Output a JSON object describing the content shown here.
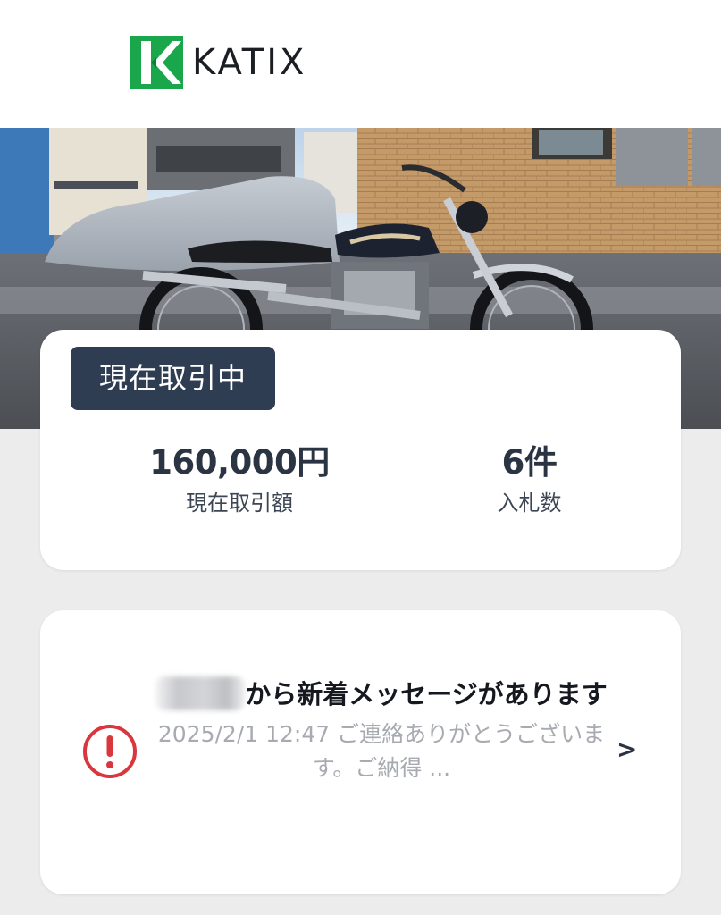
{
  "brand": {
    "name": "KATIX",
    "color": "#1aa64a"
  },
  "hero": {
    "icon": "motorcycle-photo"
  },
  "status_card": {
    "badge": "現在取引中",
    "amount_value": "160,000円",
    "amount_label": "現在取引額",
    "bids_value": "6件",
    "bids_label": "入札数"
  },
  "message_card": {
    "title": "から新着メッセージがあります",
    "preview": "2025/2/1 12:47 ご連絡ありがとうございます。ご納得 ...",
    "chevron": ">",
    "icon": "alert-circle-icon",
    "icon_color": "#d9363e"
  },
  "colors": {
    "badge_bg": "#2f3d52",
    "page_bg": "#ececed",
    "text_dark": "#2b3442",
    "text_muted": "#a7aab0"
  }
}
